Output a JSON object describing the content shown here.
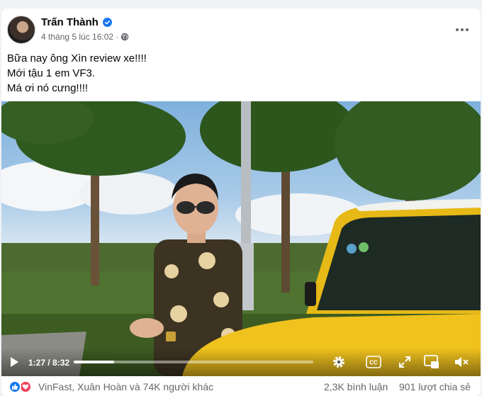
{
  "post": {
    "author": "Trấn Thành",
    "timestamp": "4 tháng 5 lúc 16:02",
    "separator": "·",
    "text_lines": [
      "Bữa nay ông Xìn review xe!!!!",
      "Mới tậu 1 em VF3.",
      "Má ơi nó cưng!!!!"
    ]
  },
  "video": {
    "current_time": "1:27",
    "duration": "8:32",
    "time_display": "1:27 / 8:32",
    "progress_fraction": 0.17
  },
  "footer": {
    "reactions_text": "VinFast, Xuân Hoàn và 74K người khác",
    "comments_text": "2,3K bình luận",
    "shares_text": "901 lượt chia sẻ"
  },
  "icons": {
    "verified": "verified-badge-icon",
    "privacy": "globe-icon",
    "more": "more-options-icon",
    "play": "play-icon",
    "settings": "gear-icon",
    "captions": "closed-captions-icon",
    "fullscreen": "fullscreen-icon",
    "miniplayer": "picture-in-picture-icon",
    "volume": "volume-muted-icon",
    "like": "like-icon",
    "love": "love-icon"
  },
  "colors": {
    "brand_blue": "#1877f2",
    "love_red": "#f33e58",
    "secondary_text": "#65676b"
  }
}
